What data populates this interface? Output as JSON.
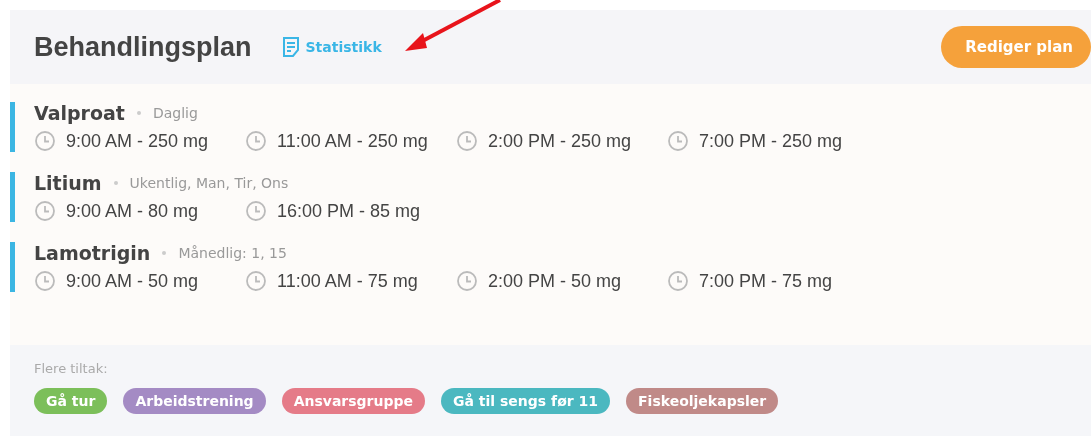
{
  "header": {
    "title": "Behandlingsplan",
    "link": "Statistikk",
    "button": "Rediger plan"
  },
  "medications": [
    {
      "name": "Valproat",
      "schedule": "Daglig",
      "doses": [
        "9:00 AM - 250 mg",
        "11:00 AM - 250 mg",
        "2:00 PM - 250 mg",
        "7:00 PM - 250 mg"
      ]
    },
    {
      "name": "Litium",
      "schedule": "Ukentlig, Man, Tir, Ons",
      "doses": [
        "9:00 AM - 80 mg",
        "16:00 PM - 85 mg"
      ]
    },
    {
      "name": "Lamotrigin",
      "schedule": "Månedlig: 1, 15",
      "doses": [
        "9:00 AM - 50 mg",
        "11:00 AM - 75 mg",
        "2:00 PM - 50 mg",
        "7:00 PM - 75 mg"
      ]
    }
  ],
  "extras": {
    "label": "Flere tiltak:",
    "tags": [
      {
        "label": "Gå tur",
        "color": "#7cbf5a"
      },
      {
        "label": "Arbeidstrening",
        "color": "#a48bc4"
      },
      {
        "label": "Ansvarsgruppe",
        "color": "#e57b88"
      },
      {
        "label": "Gå til sengs før 11",
        "color": "#4bb8c0"
      },
      {
        "label": "Fiskeoljekapsler",
        "color": "#c08a88"
      }
    ]
  }
}
